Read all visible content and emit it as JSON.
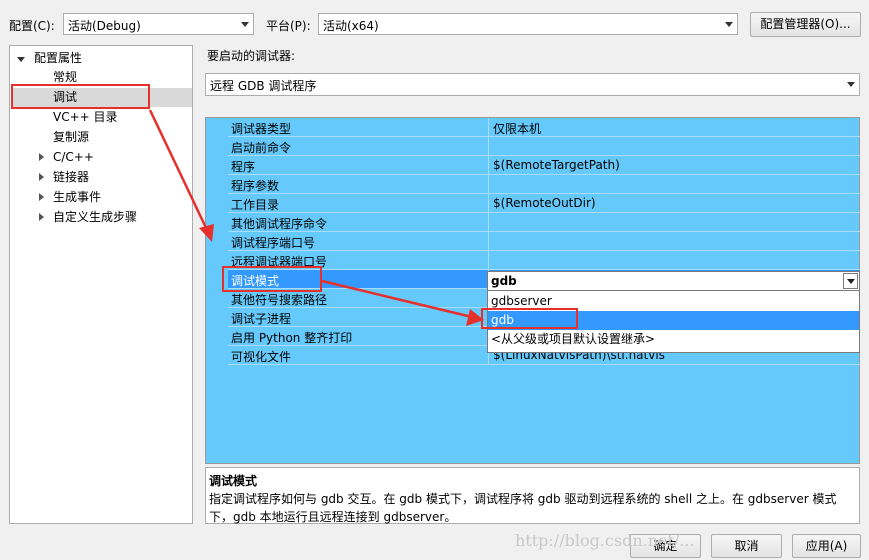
{
  "toolbar": {
    "config_label": "配置(C):",
    "config_value": "活动(Debug)",
    "platform_label": "平台(P):",
    "platform_value": "活动(x64)",
    "config_manager": "配置管理器(O)..."
  },
  "tree": {
    "root": "配置属性",
    "items": [
      {
        "label": "常规"
      },
      {
        "label": "调试"
      },
      {
        "label": "VC++ 目录"
      },
      {
        "label": "复制源"
      },
      {
        "label": "C/C++"
      },
      {
        "label": "链接器"
      },
      {
        "label": "生成事件"
      },
      {
        "label": "自定义生成步骤"
      }
    ]
  },
  "debugger": {
    "label": "要启动的调试器:",
    "value": "远程 GDB 调试程序"
  },
  "properties": [
    {
      "name": "调试器类型",
      "value": "仅限本机"
    },
    {
      "name": "启动前命令",
      "value": ""
    },
    {
      "name": "程序",
      "value": "$(RemoteTargetPath)"
    },
    {
      "name": "程序参数",
      "value": ""
    },
    {
      "name": "工作目录",
      "value": "$(RemoteOutDir)"
    },
    {
      "name": "其他调试程序命令",
      "value": ""
    },
    {
      "name": "调试程序端口号",
      "value": ""
    },
    {
      "name": "远程调试器端口号",
      "value": ""
    },
    {
      "name": "调试模式",
      "value": ""
    },
    {
      "name": "其他符号搜索路径",
      "value": ""
    },
    {
      "name": "调试子进程",
      "value": ""
    },
    {
      "name": "启用 Python 整齐打印",
      "value": ""
    },
    {
      "name": "可视化文件",
      "value": "$(LinuxNatvisPath)\\stl.natvis"
    }
  ],
  "dropdown": {
    "current": "gdb",
    "options": [
      "gdbserver",
      "gdb",
      "<从父级或项目默认设置继承>"
    ]
  },
  "description": {
    "title": "调试模式",
    "line1": "指定调试程序如何与 gdb 交互。在 gdb 模式下，调试程序将 gdb 驱动到远程系统的 shell 之上。在 gdbserver 模式",
    "line2": "下，gdb 本地运行且远程连接到 gdbserver。"
  },
  "buttons": {
    "ok": "确定",
    "cancel": "取消",
    "apply": "应用(A)"
  },
  "watermark": "http://blog.csdn.net/...",
  "colors": {
    "grid_bg": "#66c9fc",
    "selection": "#3399ff",
    "annotation": "#e5302c"
  }
}
